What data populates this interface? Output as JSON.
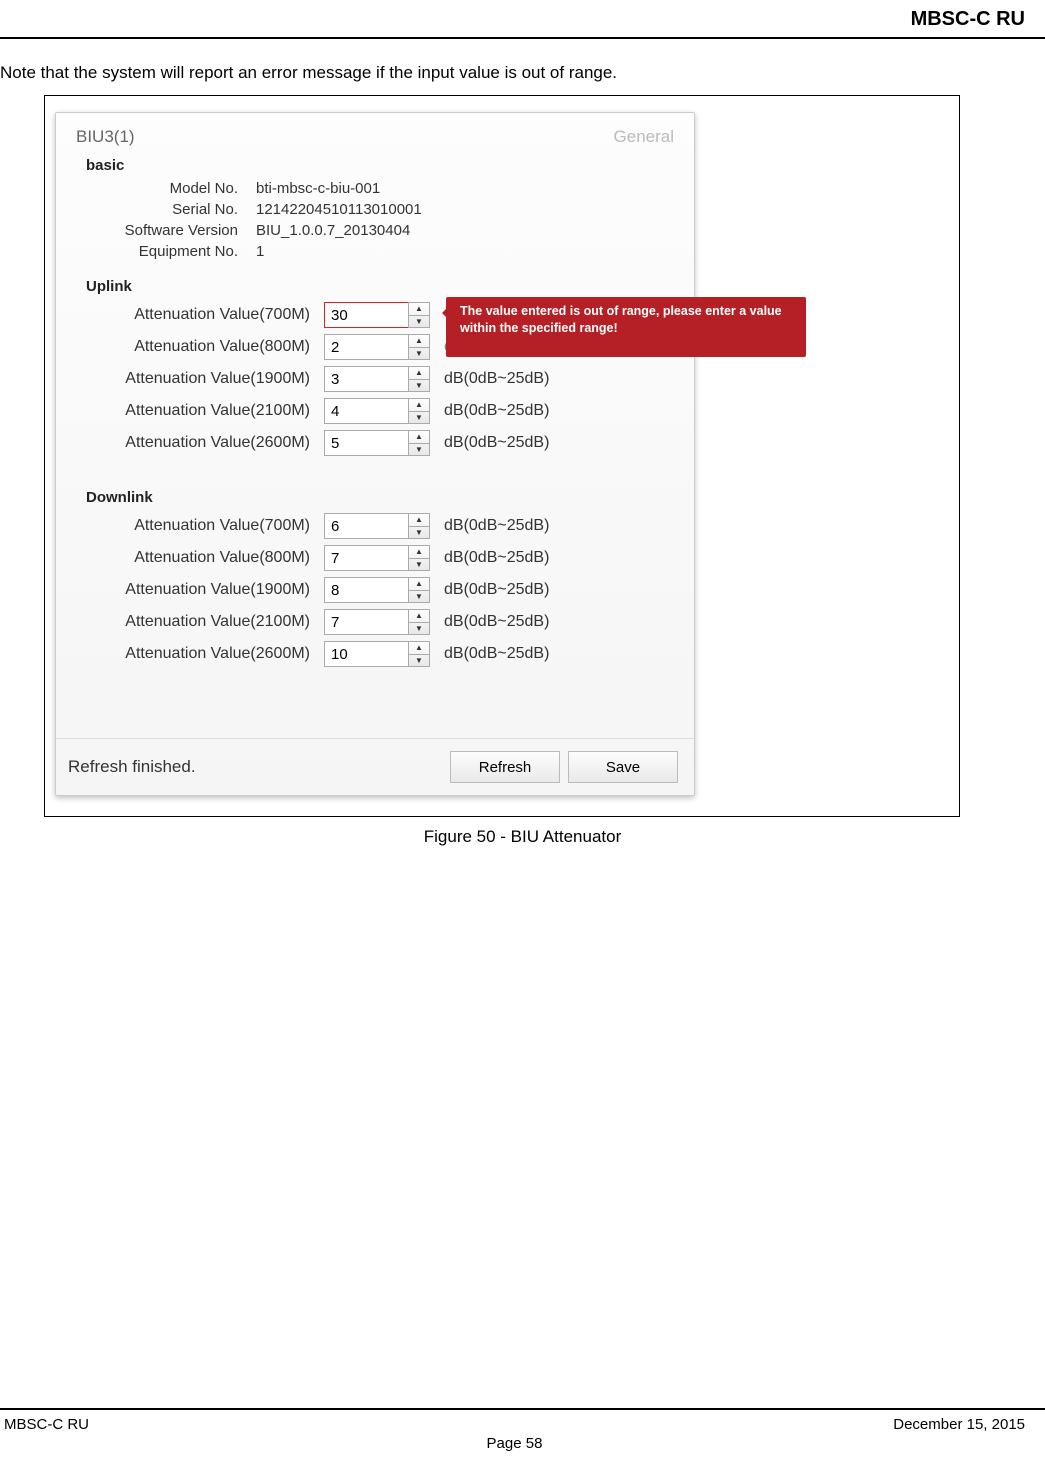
{
  "page": {
    "header": "MBSC-C RU",
    "note": "Note that the system will report an error message if the input value is out of range.",
    "figure_caption": "Figure 50 - BIU Attenuator",
    "footer_left": "MBSC-C RU",
    "footer_right": "December 15, 2015",
    "footer_center": "Page 58"
  },
  "app": {
    "title": "BIU3(1)",
    "tab": "General",
    "basic_header": "basic",
    "basic": [
      {
        "label": "Model No.",
        "value": "bti-mbsc-c-biu-001"
      },
      {
        "label": "Serial No.",
        "value": "12142204510113010001"
      },
      {
        "label": "Software Version",
        "value": "BIU_1.0.0.7_20130404"
      },
      {
        "label": "Equipment No.",
        "value": "1"
      }
    ],
    "uplink_header": "Uplink",
    "uplink": [
      {
        "label": "Attenuation Value(700M)",
        "value": "30",
        "range": "",
        "error": true
      },
      {
        "label": "Attenuation Value(800M)",
        "value": "2",
        "range": "dB(0dB~25dB)",
        "dim": true
      },
      {
        "label": "Attenuation Value(1900M)",
        "value": "3",
        "range": "dB(0dB~25dB)"
      },
      {
        "label": "Attenuation Value(2100M)",
        "value": "4",
        "range": "dB(0dB~25dB)"
      },
      {
        "label": "Attenuation Value(2600M)",
        "value": "5",
        "range": "dB(0dB~25dB)"
      }
    ],
    "downlink_header": "Downlink",
    "downlink": [
      {
        "label": "Attenuation Value(700M)",
        "value": "6",
        "range": "dB(0dB~25dB)"
      },
      {
        "label": "Attenuation Value(800M)",
        "value": "7",
        "range": "dB(0dB~25dB)"
      },
      {
        "label": "Attenuation Value(1900M)",
        "value": "8",
        "range": "dB(0dB~25dB)"
      },
      {
        "label": "Attenuation Value(2100M)",
        "value": "7",
        "range": "dB(0dB~25dB)"
      },
      {
        "label": "Attenuation Value(2600M)",
        "value": "10",
        "range": "dB(0dB~25dB)"
      }
    ],
    "error_message": "The value entered is out of range, please enter a value within the specified range!",
    "status": "Refresh finished.",
    "refresh_btn": "Refresh",
    "save_btn": "Save"
  }
}
